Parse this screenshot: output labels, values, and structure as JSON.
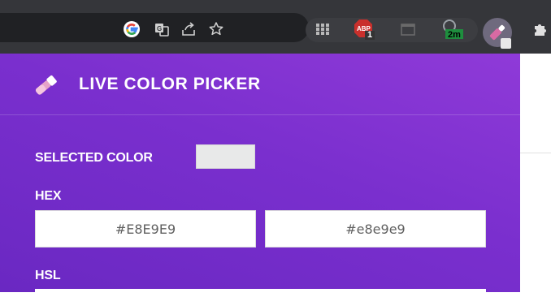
{
  "browser": {
    "icons": [
      "google-icon",
      "translate-icon",
      "share-icon",
      "bookmark-star-icon",
      "grid-icon",
      "adblock-icon",
      "window-icon",
      "timer-icon",
      "color-picker-extension-icon",
      "extensions-puzzle-icon"
    ],
    "adblock_badge": "1",
    "timer_badge": "2m"
  },
  "popup": {
    "title": "LIVE COLOR PICKER",
    "selected_label": "SELECTED COLOR",
    "selected_color": "#e8e9e9",
    "hex_label": "HEX",
    "hex_upper": "#E8E9E9",
    "hex_lower": "#e8e9e9",
    "hsl_label": "HSL"
  },
  "colors": {
    "toolbar": "#35363a",
    "popup_gradient_top": "#8f3ad8",
    "popup_gradient_bottom": "#6a28c2"
  }
}
